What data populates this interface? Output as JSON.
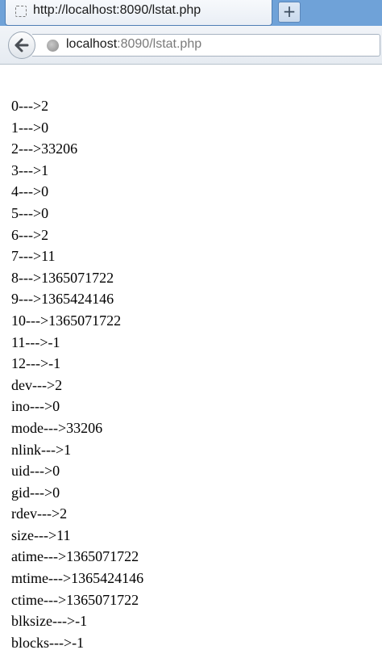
{
  "tab": {
    "title": "http://localhost:8090/lstat.php"
  },
  "newtab": {
    "label": "+"
  },
  "urlbar": {
    "host": "localhost",
    "rest": ":8090/lstat.php"
  },
  "lines": [
    "0--->2",
    "1--->0",
    "2--->33206",
    "3--->1",
    "4--->0",
    "5--->0",
    "6--->2",
    "7--->11",
    "8--->1365071722",
    "9--->1365424146",
    "10--->1365071722",
    "11--->-1",
    "12--->-1",
    "dev--->2",
    "ino--->0",
    "mode--->33206",
    "nlink--->1",
    "uid--->0",
    "gid--->0",
    "rdev--->2",
    "size--->11",
    "atime--->1365071722",
    "mtime--->1365424146",
    "ctime--->1365071722",
    "blksize--->-1",
    "blocks--->-1"
  ]
}
